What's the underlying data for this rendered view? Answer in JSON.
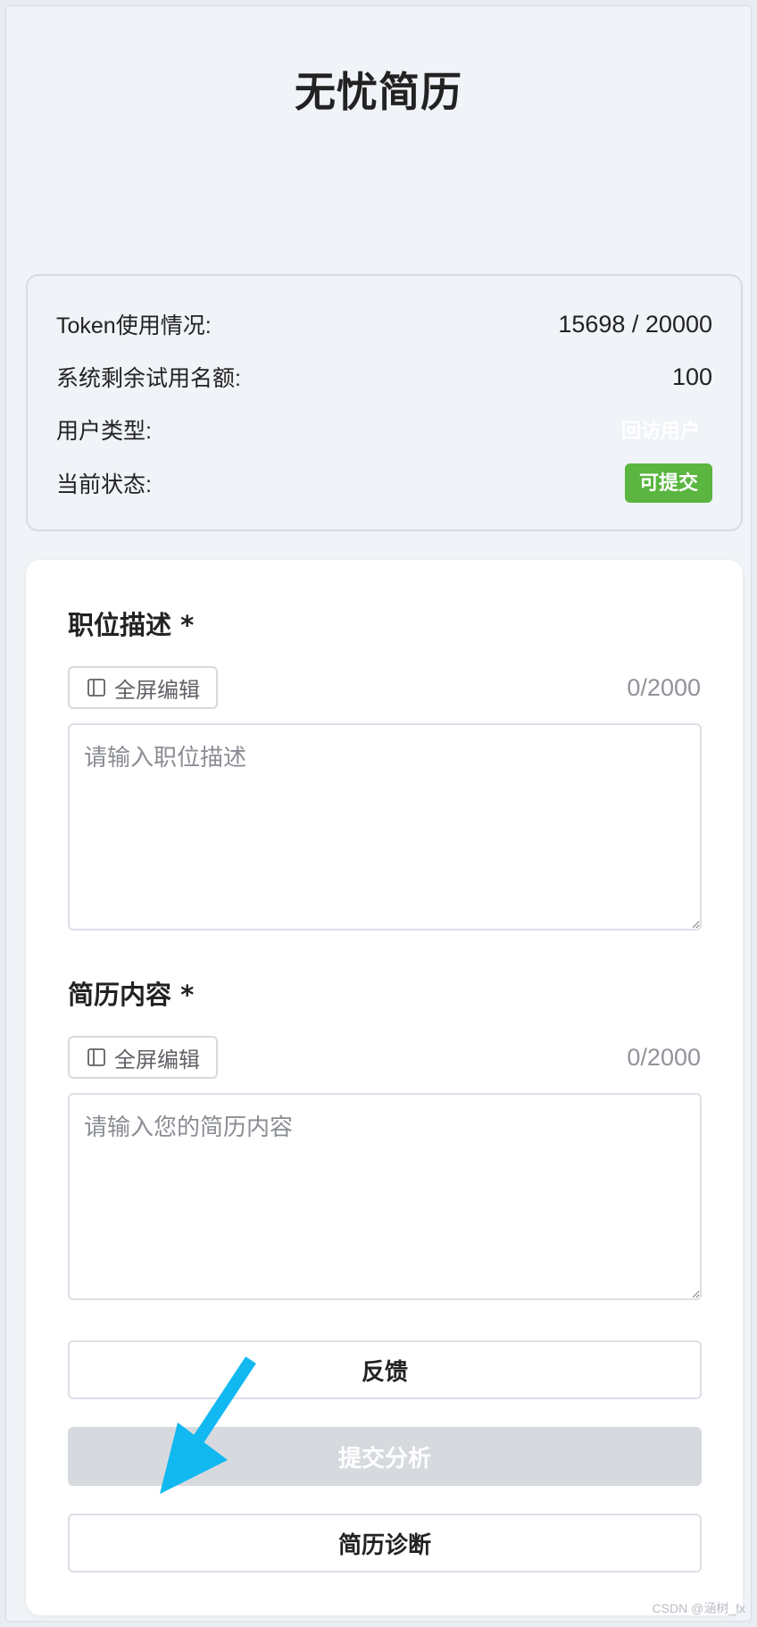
{
  "page": {
    "title": "无忧简历"
  },
  "info": {
    "token_label": "Token使用情况:",
    "token_value": "15698 / 20000",
    "quota_label": "系统剩余试用名额:",
    "quota_value": "100",
    "user_type_label": "用户类型:",
    "user_type_value": "回访用户",
    "status_label": "当前状态:",
    "status_value": "可提交"
  },
  "job": {
    "label": "职位描述 *",
    "fullscreen_label": "全屏编辑",
    "counter": "0/2000",
    "placeholder": "请输入职位描述"
  },
  "resume": {
    "label": "简历内容 *",
    "fullscreen_label": "全屏编辑",
    "counter": "0/2000",
    "placeholder": "请输入您的简历内容"
  },
  "actions": {
    "feedback": "反馈",
    "submit": "提交分析",
    "diagnose": "简历诊断"
  },
  "colors": {
    "status_badge": "#5ab640",
    "arrow": "#12b8f0",
    "disabled_button": "#d6d9de"
  },
  "icons": {
    "fullscreen": "sidebar-panel-icon",
    "annotation": "arrow-icon"
  },
  "watermark": "CSDN @涵树_fx"
}
